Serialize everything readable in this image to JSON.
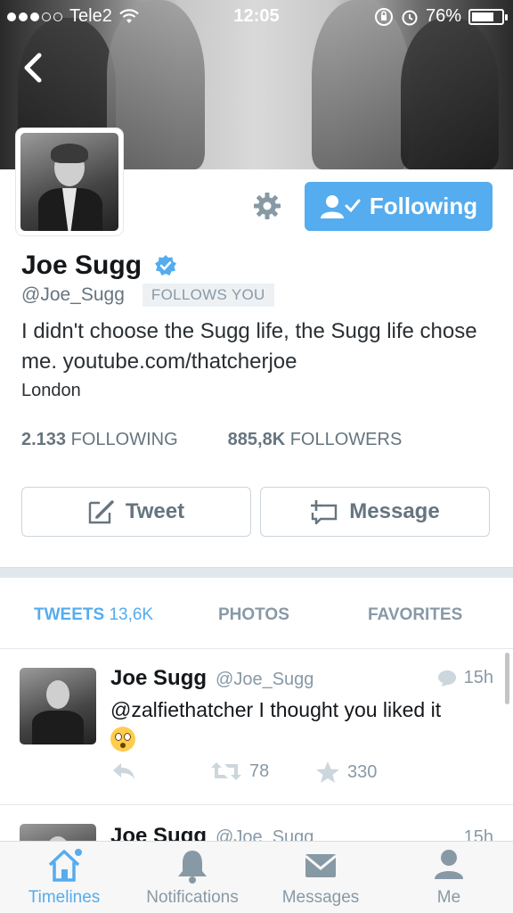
{
  "status_bar": {
    "carrier": "Tele2",
    "time": "12:05",
    "battery": "76%",
    "battery_level": 0.76
  },
  "profile": {
    "name": "Joe Sugg",
    "handle": "@Joe_Sugg",
    "follows_you": "FOLLOWS YOU",
    "verified": true,
    "bio": "I didn't choose the Sugg life, the Sugg life chose me. youtube.com/thatcherjoe",
    "location": "London",
    "following_count": "2.133",
    "following_label": "FOLLOWING",
    "followers_count": "885,8K",
    "followers_label": "FOLLOWERS"
  },
  "actions": {
    "following_label": "Following",
    "tweet_label": "Tweet",
    "message_label": "Message"
  },
  "tabs": {
    "tweets_label": "TWEETS",
    "tweets_count": "13,6K",
    "photos_label": "PHOTOS",
    "favorites_label": "FAVORITES"
  },
  "tweets": [
    {
      "name": "Joe Sugg",
      "handle": "@Joe_Sugg",
      "time": "15h",
      "text": "@zalfiethatcher I thought you liked it",
      "retweets": "78",
      "favorites": "330"
    },
    {
      "name": "Joe Sugg",
      "handle": "@Joe_Sugg",
      "time": "15h"
    }
  ],
  "tab_bar": {
    "timelines": "Timelines",
    "notifications": "Notifications",
    "messages": "Messages",
    "me": "Me"
  },
  "colors": {
    "accent": "#55acee",
    "muted": "#8899a6"
  }
}
